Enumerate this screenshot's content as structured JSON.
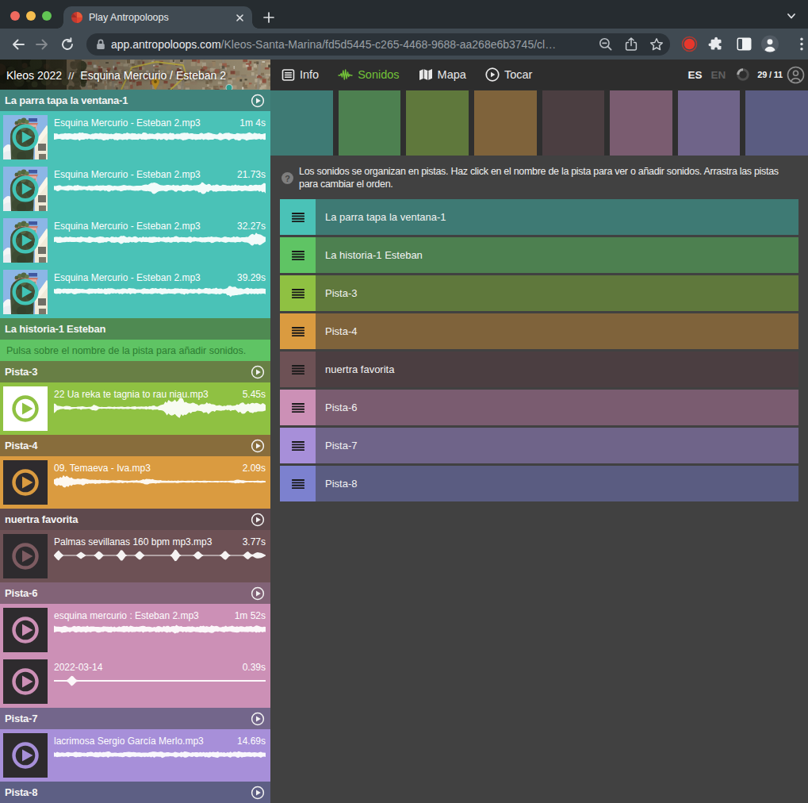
{
  "browser": {
    "tab_title": "Play Antropoloops",
    "url_host": "app.antropoloops.com",
    "url_path": "/Kleos-Santa-Marina/fd5d5445-c265-4468-9688-aa268e6b3745/cl…",
    "icons": [
      "back",
      "forward",
      "reload",
      "lock",
      "zoom-out",
      "share",
      "bookmark-star",
      "record-dot",
      "puzzle-extension",
      "side-panel",
      "profile-avatar",
      "kebab-menu"
    ]
  },
  "header": {
    "breadcrumb_project": "Kleos 2022",
    "breadcrumb_sep": "//",
    "breadcrumb_page": "Esquina Mercurio / Esteban 2",
    "nav": [
      {
        "id": "info",
        "label": "Info",
        "active": false
      },
      {
        "id": "sonidos",
        "label": "Sonidos",
        "active": true
      },
      {
        "id": "mapa",
        "label": "Mapa",
        "active": false
      },
      {
        "id": "tocar",
        "label": "Tocar",
        "active": false
      }
    ],
    "lang_es": "ES",
    "lang_en": "EN",
    "counter": "29 / 11",
    "accent_green": "#72C238"
  },
  "help": {
    "text": "Los sonidos se organizan en pistas. Haz click en el nombre de la pista para ver o añadir sonidos. Arrastra las pistas para cambiar el orden.",
    "icon_glyph": "?"
  },
  "tracks": [
    {
      "name": "La parra tapa la ventana-1",
      "bright": "#4AC2B7",
      "muted": "#3E7A74",
      "has_play": true,
      "hint": null,
      "thumb": "photo",
      "sounds": [
        {
          "title": "Esquina Mercurio - Esteban 2.mp3",
          "duration": "1m 4s",
          "wave": [
            0.3,
            0.22,
            0.26,
            0.33,
            0.24,
            0.3,
            0.36,
            0.26,
            0.22,
            0.3,
            0.25,
            0.33,
            0.28,
            0.24,
            0.31,
            0.27,
            0.35,
            0.25,
            0.29,
            0.24,
            0.32,
            0.27,
            0.23,
            0.3,
            0.26,
            0.33,
            0.28,
            0.24,
            0.3,
            0.36,
            0.26,
            0.31,
            0.25,
            0.29,
            0.34,
            0.27,
            0.23,
            0.31,
            0.26,
            0.3,
            0.25,
            0.33,
            0.28,
            0.35,
            0.27,
            0.31,
            0.26,
            0.29
          ],
          "seed": 11,
          "rough": 0.5
        },
        {
          "title": "Esquina Mercurio - Esteban 2.mp3",
          "duration": "21.73s",
          "wave": [
            0.2,
            0.26,
            0.18,
            0.24,
            0.2,
            0.28,
            0.22,
            0.18,
            0.25,
            0.2,
            0.26,
            0.22,
            0.3,
            0.24,
            0.2,
            0.28,
            0.23,
            0.19,
            0.26,
            0.21,
            0.3,
            0.26,
            0.55,
            0.38,
            0.24,
            0.28,
            0.22,
            0.3,
            0.25,
            0.35,
            0.28,
            0.24,
            0.33,
            0.52,
            0.36,
            0.26,
            0.3,
            0.24,
            0.28,
            0.22,
            0.3,
            0.25,
            0.29,
            0.24,
            0.3,
            0.26,
            0.34,
            0.45
          ],
          "seed": 22,
          "rough": 0.5
        },
        {
          "title": "Esquina Mercurio - Esteban 2.mp3",
          "duration": "32.27s",
          "wave": [
            0.22,
            0.28,
            0.2,
            0.26,
            0.22,
            0.18,
            0.25,
            0.2,
            0.26,
            0.21,
            0.28,
            0.23,
            0.19,
            0.26,
            0.21,
            0.38,
            0.28,
            0.22,
            0.26,
            0.2,
            0.25,
            0.22,
            0.28,
            0.23,
            0.2,
            0.26,
            0.22,
            0.28,
            0.24,
            0.2,
            0.27,
            0.22,
            0.18,
            0.25,
            0.21,
            0.27,
            0.23,
            0.19,
            0.26,
            0.21,
            0.28,
            0.24,
            0.2,
            0.26,
            0.48,
            0.55,
            0.42,
            0.2
          ],
          "seed": 33,
          "rough": 0.5
        },
        {
          "title": "Esquina Mercurio - Esteban 2.mp3",
          "duration": "39.29s",
          "wave": [
            0.2,
            0.25,
            0.19,
            0.24,
            0.2,
            0.26,
            0.21,
            0.18,
            0.24,
            0.2,
            0.26,
            0.21,
            0.27,
            0.22,
            0.19,
            0.25,
            0.21,
            0.26,
            0.22,
            0.18,
            0.25,
            0.2,
            0.26,
            0.22,
            0.28,
            0.23,
            0.19,
            0.25,
            0.21,
            0.27,
            0.22,
            0.19,
            0.25,
            0.2,
            0.26,
            0.22,
            0.28,
            0.24,
            0.2,
            0.5,
            0.42,
            0.28,
            0.24,
            0.28,
            0.22,
            0.26,
            0.21,
            0.25
          ],
          "seed": 44,
          "rough": 0.5
        }
      ],
      "muted_hdr": "#40837C"
    },
    {
      "name": "La historia-1 Esteban",
      "bright": "#5FC464",
      "muted": "#4D8050",
      "has_play": false,
      "hint": "Pulsa sobre el nombre de la pista para añadir sonidos.",
      "hint_color": "#2E7D33",
      "thumb": "dark",
      "sounds": [],
      "muted_hdr": "#4F8A52"
    },
    {
      "name": "Pista-3",
      "bright": "#8FC142",
      "muted": "#5F783C",
      "has_play": true,
      "hint": null,
      "thumb": "white",
      "sounds": [
        {
          "title": "22 Ua reka te tagnia to rau niau.mp3",
          "duration": "5.45s",
          "wave": [
            0.42,
            0.2,
            0.1,
            0.22,
            0.09,
            0.08,
            0.15,
            0.09,
            0.08,
            0.3,
            0.1,
            0.08,
            0.09,
            0.08,
            0.1,
            0.09,
            0.1,
            0.09,
            0.13,
            0.1,
            0.15,
            0.12,
            0.18,
            0.14,
            0.25,
            0.55,
            0.78,
            0.62,
            0.8,
            0.66,
            0.45,
            0.38,
            0.25,
            0.38,
            0.52,
            0.42,
            0.28,
            0.22,
            0.18,
            0.24,
            0.2,
            0.38,
            0.48,
            0.34,
            0.44,
            0.36,
            0.42,
            0.25
          ],
          "seed": 55,
          "rough": 0.6
        }
      ],
      "muted_hdr": "#687F45"
    },
    {
      "name": "Pista-4",
      "bright": "#DA9B40",
      "muted": "#7F633B",
      "has_play": true,
      "hint": null,
      "thumb": "dark",
      "sounds": [
        {
          "title": "09. Temaeva - Iva.mp3",
          "duration": "2.09s",
          "wave": [
            0.25,
            0.38,
            0.5,
            0.43,
            0.35,
            0.27,
            0.3,
            0.24,
            0.16,
            0.2,
            0.16,
            0.13,
            0.15,
            0.12,
            0.11,
            0.13,
            0.11,
            0.1,
            0.12,
            0.1,
            0.22,
            0.26,
            0.18,
            0.13,
            0.11,
            0.1,
            0.09,
            0.11,
            0.09,
            0.08,
            0.1,
            0.08,
            0.07,
            0.09,
            0.08,
            0.07,
            0.08,
            0.07,
            0.06,
            0.08,
            0.13,
            0.16,
            0.12,
            0.07,
            0.06,
            0.09,
            0.08,
            0.07
          ],
          "seed": 66,
          "rough": 0.55
        }
      ],
      "muted_hdr": "#886D3C"
    },
    {
      "name": "nuertra favorita",
      "bright": "#6D5155",
      "muted": "#4B3E41",
      "has_play": true,
      "hint": null,
      "thumb": "dark",
      "ring": "#7D5B61",
      "sounds": [
        {
          "title": "Palmas sevillanas 160 bpm mp3.mp3",
          "duration": "3.77s",
          "wave": [
            0.045,
            0.5,
            0.045,
            0.045,
            0.045,
            0.045,
            0.34,
            0.045,
            0.045,
            0.045,
            0.44,
            0.045,
            0.045,
            0.045,
            0.045,
            0.58,
            0.045,
            0.045,
            0.045,
            0.46,
            0.045,
            0.045,
            0.045,
            0.045,
            0.045,
            0.045,
            0.045,
            0.62,
            0.045,
            0.045,
            0.045,
            0.045,
            0.42,
            0.045,
            0.045,
            0.045,
            0.045,
            0.045,
            0.46,
            0.045,
            0.045,
            0.045,
            0.045,
            0.4,
            0.045,
            0.3,
            0.24,
            0.045
          ],
          "seed": 77,
          "rough": 0.08
        }
      ],
      "muted_hdr": "#5E494D"
    },
    {
      "name": "Pista-6",
      "bright": "#CC90B6",
      "muted": "#7A5C70",
      "has_play": true,
      "hint": null,
      "thumb": "dark",
      "sounds": [
        {
          "title": "esquina mercurio : Esteban 2.mp3",
          "duration": "1m 52s",
          "wave": [
            0.28,
            0.24,
            0.3,
            0.26,
            0.22,
            0.28,
            0.24,
            0.3,
            0.25,
            0.21,
            0.27,
            0.23,
            0.29,
            0.25,
            0.21,
            0.27,
            0.24,
            0.3,
            0.26,
            0.22,
            0.28,
            0.24,
            0.2,
            0.26,
            0.23,
            0.29,
            0.25,
            0.35,
            0.27,
            0.23,
            0.29,
            0.25,
            0.21,
            0.33,
            0.24,
            0.3,
            0.26,
            0.22,
            0.28,
            0.24,
            0.3,
            0.26,
            0.22,
            0.28,
            0.25,
            0.31,
            0.27,
            0.23
          ],
          "seed": 88,
          "rough": 0.55
        },
        {
          "title": "2022-03-14",
          "duration": "0.39s",
          "wave": [
            0.08,
            0.08,
            0.08,
            0.08,
            0.52,
            0.08,
            0.08,
            0.08,
            0.08,
            0.08,
            0.08,
            0.08,
            0.08,
            0.08,
            0.08,
            0.08,
            0.08,
            0.08,
            0.08,
            0.08,
            0.08,
            0.08,
            0.08,
            0.08,
            0.08,
            0.08,
            0.08,
            0.08,
            0.08,
            0.08,
            0.08,
            0.08,
            0.08,
            0.08,
            0.08,
            0.08,
            0.08,
            0.08,
            0.08,
            0.08,
            0.08,
            0.08,
            0.08,
            0.08,
            0.08,
            0.08,
            0.08,
            0.08
          ],
          "seed": 99,
          "rough": 0.05
        }
      ],
      "muted_hdr": "#826377"
    },
    {
      "name": "Pista-7",
      "bright": "#A78FD9",
      "muted": "#6F6489",
      "has_play": true,
      "hint": null,
      "thumb": "dark",
      "sounds": [
        {
          "title": "lacrimosa Sergio García Merlo.mp3",
          "duration": "14.69s",
          "wave": [
            0.18,
            0.22,
            0.17,
            0.21,
            0.18,
            0.24,
            0.2,
            0.17,
            0.22,
            0.18,
            0.24,
            0.2,
            0.26,
            0.21,
            0.18,
            0.23,
            0.19,
            0.25,
            0.21,
            0.17,
            0.23,
            0.19,
            0.24,
            0.2,
            0.26,
            0.22,
            0.18,
            0.23,
            0.2,
            0.25,
            0.21,
            0.17,
            0.23,
            0.19,
            0.24,
            0.2,
            0.26,
            0.22,
            0.18,
            0.24,
            0.2,
            0.25,
            0.21,
            0.18,
            0.23,
            0.2,
            0.24,
            0.2
          ],
          "seed": 111,
          "rough": 0.55
        }
      ],
      "muted_hdr": "#73668B"
    },
    {
      "name": "Pista-8",
      "bright": "#7C81CF",
      "muted": "#5A5C81",
      "has_play": true,
      "hint": null,
      "thumb": "dark",
      "sounds": [],
      "muted_hdr": "#5D5F84"
    }
  ]
}
